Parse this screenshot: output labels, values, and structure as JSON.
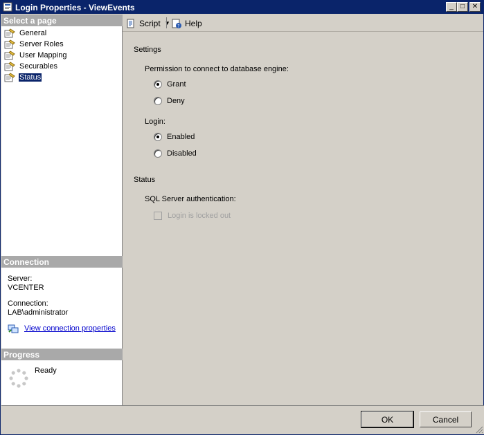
{
  "window": {
    "title": "Login Properties - ViewEvents",
    "controls": {
      "minimize": "_",
      "maximize": "□",
      "close": "✕"
    }
  },
  "left_pane": {
    "select_page_header": "Select a page",
    "pages": [
      {
        "label": "General",
        "icon": "page-icon",
        "selected": false
      },
      {
        "label": "Server Roles",
        "icon": "page-icon",
        "selected": false
      },
      {
        "label": "User Mapping",
        "icon": "page-icon",
        "selected": false
      },
      {
        "label": "Securables",
        "icon": "page-icon",
        "selected": false
      },
      {
        "label": "Status",
        "icon": "page-icon",
        "selected": true
      }
    ],
    "connection_header": "Connection",
    "server_label": "Server:",
    "server_value": "VCENTER",
    "connection_label": "Connection:",
    "connection_value": "LAB\\administrator",
    "view_connection_link": "View connection properties",
    "progress_header": "Progress",
    "progress_status": "Ready"
  },
  "toolbar": {
    "script_label": "Script",
    "help_label": "Help"
  },
  "content": {
    "settings_heading": "Settings",
    "permission_label": "Permission to connect to database engine:",
    "permission_options": [
      {
        "label": "Grant",
        "checked": true
      },
      {
        "label": "Deny",
        "checked": false
      }
    ],
    "login_label": "Login:",
    "login_options": [
      {
        "label": "Enabled",
        "checked": true
      },
      {
        "label": "Disabled",
        "checked": false
      }
    ],
    "status_heading": "Status",
    "sql_auth_label": "SQL Server authentication:",
    "locked_out_label": "Login is locked out",
    "locked_out_checked": false,
    "locked_out_enabled": false
  },
  "buttons": {
    "ok": "OK",
    "cancel": "Cancel"
  },
  "colors": {
    "titlebar": "#0a246a",
    "header_gray": "#a9a9a9",
    "link": "#0000cc",
    "face": "#d4d0c8"
  }
}
